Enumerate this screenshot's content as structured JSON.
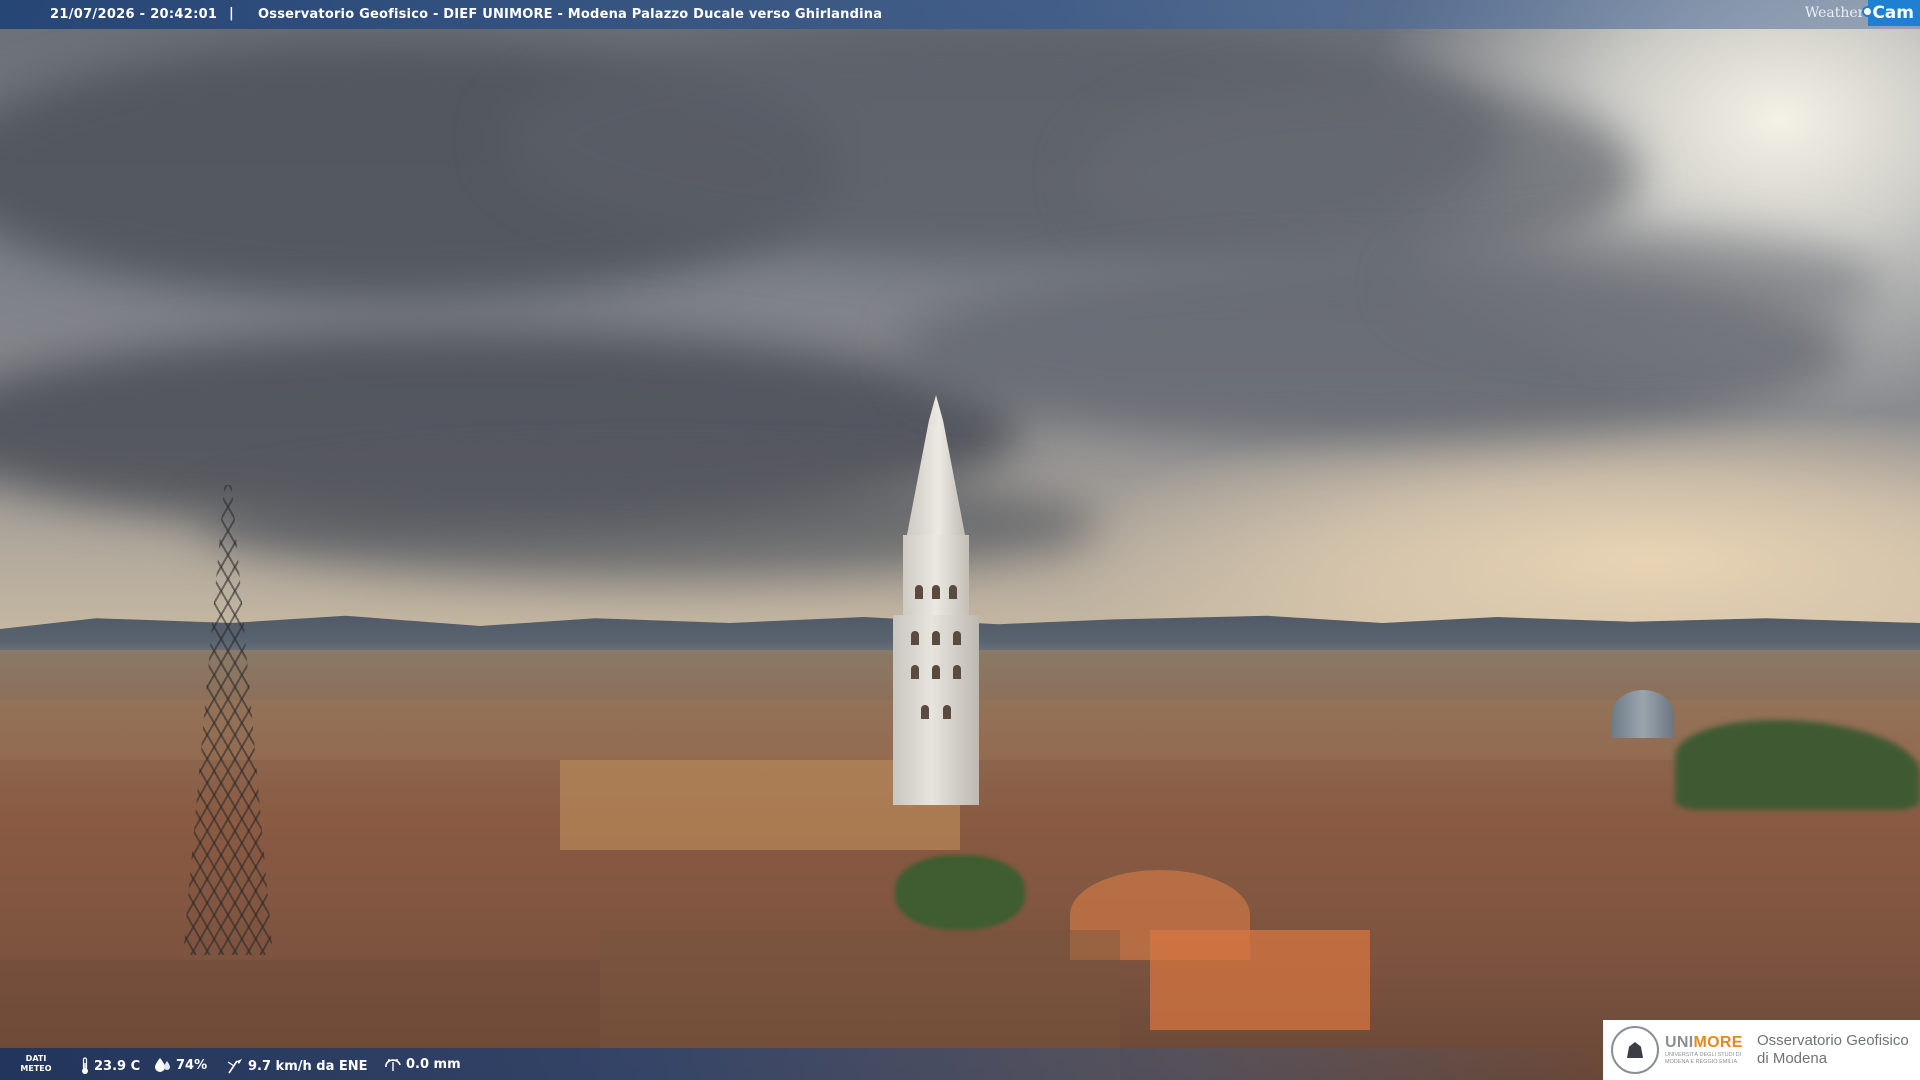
{
  "header": {
    "timestamp": "21/07/2026 - 20:42:01",
    "separator": "|",
    "camera_title": "Osservatorio Geofisico - DIEF UNIMORE - Modena Palazzo Ducale verso Ghirlandina",
    "brand_weather": "Weather",
    "brand_cam": "Cam"
  },
  "weather": {
    "label_line1": "DATI",
    "label_line2": "METEO",
    "temperature": "23.9 C",
    "humidity": "74%",
    "wind": "9.7 km/h da ENE",
    "rain": "0.0 mm",
    "icons": [
      "thermometer-icon",
      "humidity-drop-icon",
      "wind-vane-icon",
      "rain-gauge-icon"
    ]
  },
  "logo": {
    "uni_name_prefix": "UNI",
    "uni_name_suffix": "MORE",
    "uni_subtitle": "UNIVERSITÀ DEGLI STUDI DI MODENA E REGGIO EMILIA",
    "observatory_line1": "Osservatorio Geofisico",
    "observatory_line2": "di Modena"
  },
  "colors": {
    "accent_orange": "#e38a1f",
    "brand_blue": "#1f7fd0",
    "bar_blue": "#204276"
  }
}
